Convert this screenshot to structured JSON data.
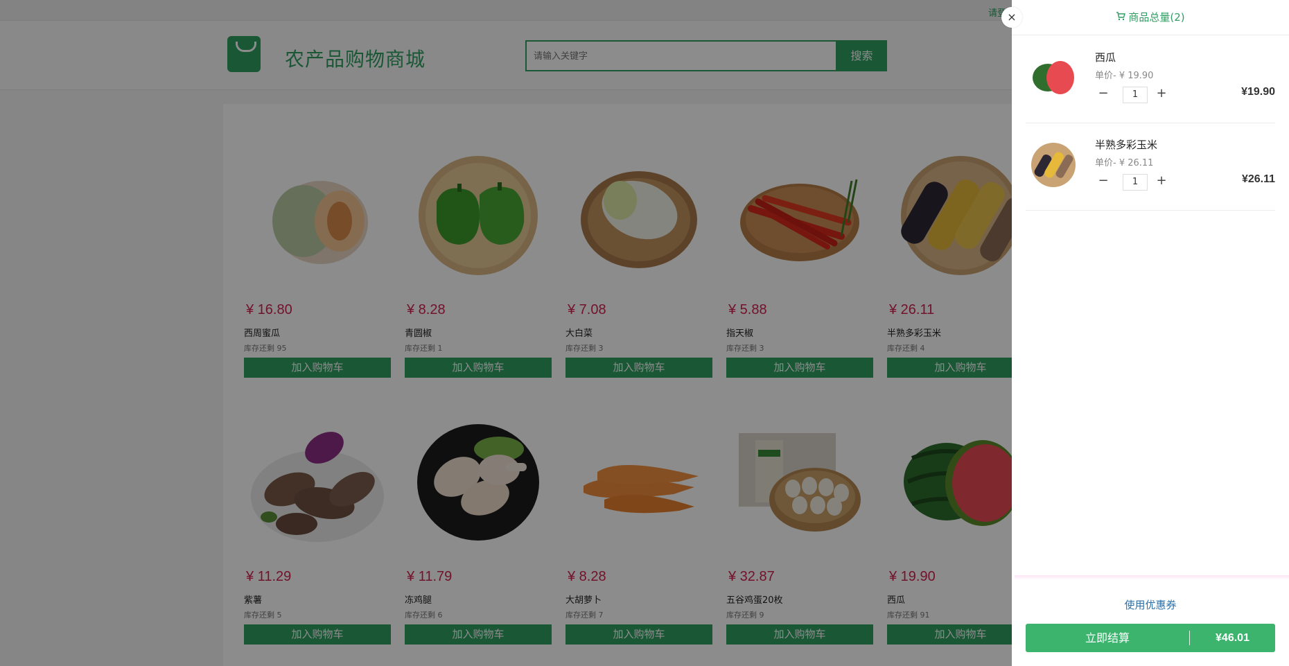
{
  "topbar": {
    "login_text": "请登"
  },
  "header": {
    "title": "农产品购物商城",
    "search_placeholder": "请输入关键字",
    "search_button": "搜索"
  },
  "products": [
    {
      "price": "¥ 16.80",
      "name": "西周蜜瓜",
      "stock": "库存还剩 95",
      "add_label": "加入购物车",
      "icon": "melon-image"
    },
    {
      "price": "¥ 8.28",
      "name": "青圆椒",
      "stock": "库存还剩 1",
      "add_label": "加入购物车",
      "icon": "green-pepper-image"
    },
    {
      "price": "¥ 7.08",
      "name": "大白菜",
      "stock": "库存还剩 3",
      "add_label": "加入购物车",
      "icon": "cabbage-image"
    },
    {
      "price": "¥ 5.88",
      "name": "指天椒",
      "stock": "库存还剩 3",
      "add_label": "加入购物车",
      "icon": "chili-image"
    },
    {
      "price": "¥ 26.11",
      "name": "半熟多彩玉米",
      "stock": "库存还剩 4",
      "add_label": "加入购物车",
      "icon": "corn-image"
    },
    {
      "price": "¥ 11.29",
      "name": "紫薯",
      "stock": "库存还剩 5",
      "add_label": "加入购物车",
      "icon": "sweet-potato-image"
    },
    {
      "price": "¥ 11.79",
      "name": "冻鸡腿",
      "stock": "库存还剩 6",
      "add_label": "加入购物车",
      "icon": "chicken-leg-image"
    },
    {
      "price": "¥ 8.28",
      "name": "大胡萝卜",
      "stock": "库存还剩 7",
      "add_label": "加入购物车",
      "icon": "carrot-image"
    },
    {
      "price": "¥ 32.87",
      "name": "五谷鸡蛋20枚",
      "stock": "库存还剩 9",
      "add_label": "加入购物车",
      "icon": "eggs-image"
    },
    {
      "price": "¥ 19.90",
      "name": "西瓜",
      "stock": "库存还剩 91",
      "add_label": "加入购物车",
      "icon": "watermelon-image"
    }
  ],
  "cart": {
    "close_glyph": "×",
    "title": "商品总量(2)",
    "items": [
      {
        "name": "西瓜",
        "unit_price": "单价- ¥ 19.90",
        "qty": "1",
        "subtotal": "¥19.90",
        "minus": "−",
        "plus": "+"
      },
      {
        "name": "半熟多彩玉米",
        "unit_price": "单价- ¥ 26.11",
        "qty": "1",
        "subtotal": "¥26.11",
        "minus": "−",
        "plus": "+"
      }
    ],
    "coupon": "使用优惠券",
    "checkout_label": "立即结算",
    "total": "¥46.01"
  },
  "colors": {
    "accent": "#2e9e62",
    "price": "#d1214f",
    "checkout": "#3cb46e",
    "link": "#2a6fa8"
  }
}
